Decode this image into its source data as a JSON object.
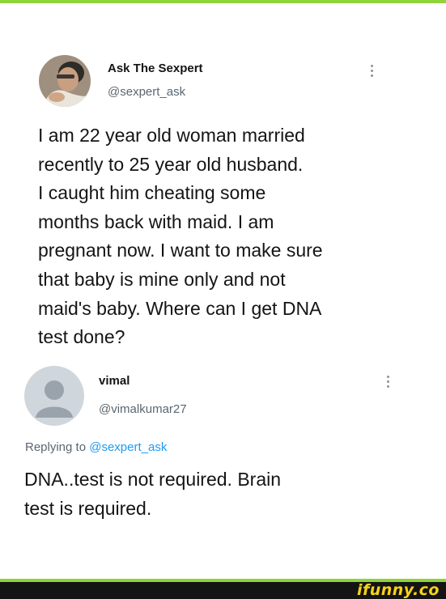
{
  "original_tweet": {
    "display_name": "Ask The Sexpert",
    "handle": "@sexpert_ask",
    "text_lines": [
      "I am 22 year old woman married",
      "recently to 25 year old husband.",
      "I caught him cheating some",
      "months back with maid. I am",
      "pregnant now. I want to make sure",
      "that baby is mine only and not",
      "maid's baby. Where can I get DNA",
      "test done?"
    ]
  },
  "reply_tweet": {
    "display_name": "vimal",
    "handle": "@vimalkumar27",
    "replying_to_prefix": "Replying to ",
    "replying_to_handle": "@sexpert_ask",
    "text_lines": [
      "DNA..test is not required. Brain",
      "test is required."
    ]
  },
  "watermark": "ifunny.co",
  "colors": {
    "accent_green": "#8fd43a",
    "link_blue": "#1d9bf0",
    "watermark_yellow": "#f7d318"
  },
  "icons": [
    "more-options-icon",
    "default-avatar-icon"
  ]
}
